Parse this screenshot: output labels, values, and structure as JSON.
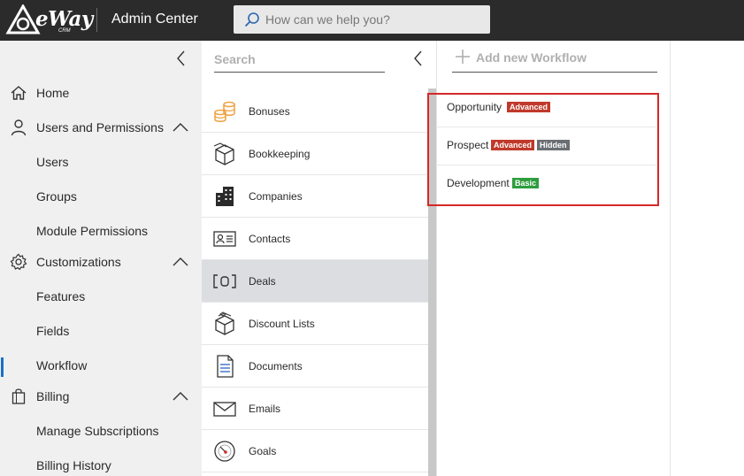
{
  "app": {
    "logo_text": "eWay",
    "logo_sub": "CRM",
    "title": "Admin Center",
    "search_placeholder": "How can we help you?"
  },
  "sidebar": {
    "items": [
      {
        "label": "Home",
        "icon": "home-icon"
      },
      {
        "label": "Users and Permissions",
        "icon": "user-icon",
        "expanded": true
      },
      {
        "label": "Users"
      },
      {
        "label": "Groups"
      },
      {
        "label": "Module Permissions"
      },
      {
        "label": "Customizations",
        "icon": "gear-icon",
        "expanded": true
      },
      {
        "label": "Features"
      },
      {
        "label": "Fields"
      },
      {
        "label": "Workflow",
        "active": true
      },
      {
        "label": "Billing",
        "icon": "shopping-bag-icon",
        "expanded": true
      },
      {
        "label": "Manage Subscriptions"
      },
      {
        "label": "Billing History"
      }
    ]
  },
  "modules": {
    "search_placeholder": "Search",
    "items": [
      {
        "label": "Bonuses",
        "icon": "coins-icon"
      },
      {
        "label": "Bookkeeping",
        "icon": "box-icon"
      },
      {
        "label": "Companies",
        "icon": "building-icon"
      },
      {
        "label": "Contacts",
        "icon": "contact-card-icon"
      },
      {
        "label": "Deals",
        "icon": "deal-brackets-icon",
        "selected": true
      },
      {
        "label": "Discount Lists",
        "icon": "discount-box-icon"
      },
      {
        "label": "Documents",
        "icon": "document-icon"
      },
      {
        "label": "Emails",
        "icon": "envelope-icon"
      },
      {
        "label": "Goals",
        "icon": "target-icon"
      }
    ]
  },
  "workflow": {
    "add_label": "Add new Workflow",
    "items": [
      {
        "label": "Opportunity",
        "badges": [
          "Advanced"
        ]
      },
      {
        "label": "Prospect",
        "badges": [
          "Advanced",
          "Hidden"
        ]
      },
      {
        "label": "Development",
        "badges": [
          "Basic"
        ]
      }
    ]
  },
  "colors": {
    "topbar": "#2b2b2b",
    "accent": "#1a6fc9",
    "highlight_border": "#d62828",
    "badge_advanced": "#c0392b",
    "badge_hidden": "#6b6f73",
    "badge_basic": "#2e9d3e",
    "coin_icon": "#f0a040"
  }
}
